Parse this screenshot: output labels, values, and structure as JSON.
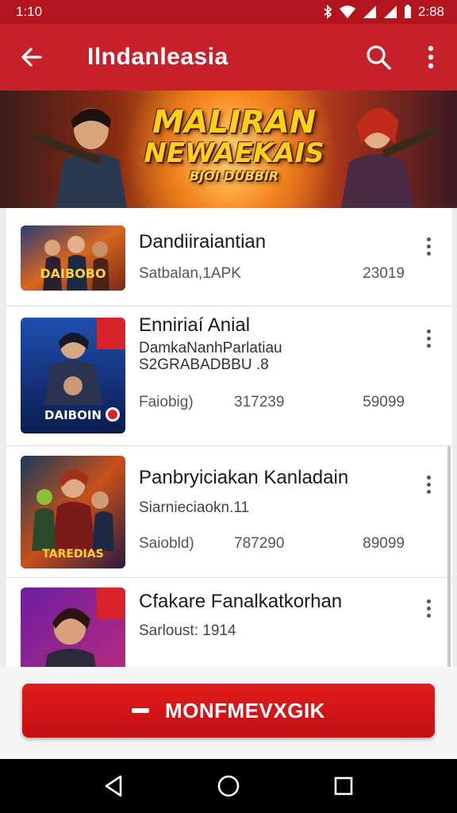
{
  "status_bar": {
    "time": "1:10",
    "right_time": "2:88"
  },
  "app_bar": {
    "title": "Ilndanleasia"
  },
  "banner": {
    "title_line1": "MALIRAN",
    "title_line2": "NEWAEKAIS",
    "title_line3": "BJOI DUBBIR"
  },
  "items": [
    {
      "title": "Dandiiraiantian",
      "subtitle": "",
      "meta": "Satbalan,1APK",
      "mid": "",
      "number": "23019",
      "thumb_label": "DAIBOBO"
    },
    {
      "title": "Enniriaí Anial",
      "subtitle": "DamkaNanhParlatiau",
      "subtitle2": "S2GRABADBBU .8",
      "meta": "Faiobig)",
      "mid": "317239",
      "number": "59099",
      "thumb_label": "DAIBOIN"
    },
    {
      "title": "Panbryiciakan Kanladain",
      "subtitle": "",
      "meta": "Siarnieciaokn.11",
      "meta_row2": "Saiobld)",
      "mid": "787290",
      "number": "89099",
      "thumb_label": "TAREDIAS"
    },
    {
      "title": "Cfakare Fanalkatkorhan",
      "subtitle": "",
      "meta": "Sarloust: 1914",
      "mid": "",
      "number": "",
      "thumb_label": ""
    }
  ],
  "cta": {
    "label": "MONFMEVXGIK"
  },
  "colors": {
    "primary": "#c8202a",
    "status": "#b3141d",
    "cta": "#d8151a"
  },
  "icons": [
    "back-arrow-icon",
    "search-icon",
    "more-vert-icon",
    "nav-back-icon",
    "nav-home-icon",
    "nav-recents-icon"
  ]
}
